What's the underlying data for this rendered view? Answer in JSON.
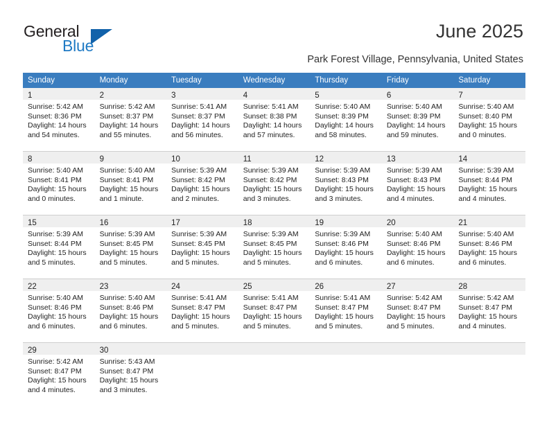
{
  "brand": {
    "name_top": "General",
    "name_bottom": "Blue",
    "color_dark": "#231f20",
    "color_blue": "#1f7ac4",
    "triangle_icon": "triangle-icon"
  },
  "header": {
    "title": "June 2025",
    "subtitle": "Park Forest Village, Pennsylvania, United States"
  },
  "calendar": {
    "header_bg": "#3a7dbf",
    "daynum_bg": "#efefef",
    "weekdays": [
      "Sunday",
      "Monday",
      "Tuesday",
      "Wednesday",
      "Thursday",
      "Friday",
      "Saturday"
    ],
    "weeks": [
      [
        {
          "day": "1",
          "sunrise": "Sunrise: 5:42 AM",
          "sunset": "Sunset: 8:36 PM",
          "daylight1": "Daylight: 14 hours",
          "daylight2": "and 54 minutes."
        },
        {
          "day": "2",
          "sunrise": "Sunrise: 5:42 AM",
          "sunset": "Sunset: 8:37 PM",
          "daylight1": "Daylight: 14 hours",
          "daylight2": "and 55 minutes."
        },
        {
          "day": "3",
          "sunrise": "Sunrise: 5:41 AM",
          "sunset": "Sunset: 8:37 PM",
          "daylight1": "Daylight: 14 hours",
          "daylight2": "and 56 minutes."
        },
        {
          "day": "4",
          "sunrise": "Sunrise: 5:41 AM",
          "sunset": "Sunset: 8:38 PM",
          "daylight1": "Daylight: 14 hours",
          "daylight2": "and 57 minutes."
        },
        {
          "day": "5",
          "sunrise": "Sunrise: 5:40 AM",
          "sunset": "Sunset: 8:39 PM",
          "daylight1": "Daylight: 14 hours",
          "daylight2": "and 58 minutes."
        },
        {
          "day": "6",
          "sunrise": "Sunrise: 5:40 AM",
          "sunset": "Sunset: 8:39 PM",
          "daylight1": "Daylight: 14 hours",
          "daylight2": "and 59 minutes."
        },
        {
          "day": "7",
          "sunrise": "Sunrise: 5:40 AM",
          "sunset": "Sunset: 8:40 PM",
          "daylight1": "Daylight: 15 hours",
          "daylight2": "and 0 minutes."
        }
      ],
      [
        {
          "day": "8",
          "sunrise": "Sunrise: 5:40 AM",
          "sunset": "Sunset: 8:41 PM",
          "daylight1": "Daylight: 15 hours",
          "daylight2": "and 0 minutes."
        },
        {
          "day": "9",
          "sunrise": "Sunrise: 5:40 AM",
          "sunset": "Sunset: 8:41 PM",
          "daylight1": "Daylight: 15 hours",
          "daylight2": "and 1 minute."
        },
        {
          "day": "10",
          "sunrise": "Sunrise: 5:39 AM",
          "sunset": "Sunset: 8:42 PM",
          "daylight1": "Daylight: 15 hours",
          "daylight2": "and 2 minutes."
        },
        {
          "day": "11",
          "sunrise": "Sunrise: 5:39 AM",
          "sunset": "Sunset: 8:42 PM",
          "daylight1": "Daylight: 15 hours",
          "daylight2": "and 3 minutes."
        },
        {
          "day": "12",
          "sunrise": "Sunrise: 5:39 AM",
          "sunset": "Sunset: 8:43 PM",
          "daylight1": "Daylight: 15 hours",
          "daylight2": "and 3 minutes."
        },
        {
          "day": "13",
          "sunrise": "Sunrise: 5:39 AM",
          "sunset": "Sunset: 8:43 PM",
          "daylight1": "Daylight: 15 hours",
          "daylight2": "and 4 minutes."
        },
        {
          "day": "14",
          "sunrise": "Sunrise: 5:39 AM",
          "sunset": "Sunset: 8:44 PM",
          "daylight1": "Daylight: 15 hours",
          "daylight2": "and 4 minutes."
        }
      ],
      [
        {
          "day": "15",
          "sunrise": "Sunrise: 5:39 AM",
          "sunset": "Sunset: 8:44 PM",
          "daylight1": "Daylight: 15 hours",
          "daylight2": "and 5 minutes."
        },
        {
          "day": "16",
          "sunrise": "Sunrise: 5:39 AM",
          "sunset": "Sunset: 8:45 PM",
          "daylight1": "Daylight: 15 hours",
          "daylight2": "and 5 minutes."
        },
        {
          "day": "17",
          "sunrise": "Sunrise: 5:39 AM",
          "sunset": "Sunset: 8:45 PM",
          "daylight1": "Daylight: 15 hours",
          "daylight2": "and 5 minutes."
        },
        {
          "day": "18",
          "sunrise": "Sunrise: 5:39 AM",
          "sunset": "Sunset: 8:45 PM",
          "daylight1": "Daylight: 15 hours",
          "daylight2": "and 5 minutes."
        },
        {
          "day": "19",
          "sunrise": "Sunrise: 5:39 AM",
          "sunset": "Sunset: 8:46 PM",
          "daylight1": "Daylight: 15 hours",
          "daylight2": "and 6 minutes."
        },
        {
          "day": "20",
          "sunrise": "Sunrise: 5:40 AM",
          "sunset": "Sunset: 8:46 PM",
          "daylight1": "Daylight: 15 hours",
          "daylight2": "and 6 minutes."
        },
        {
          "day": "21",
          "sunrise": "Sunrise: 5:40 AM",
          "sunset": "Sunset: 8:46 PM",
          "daylight1": "Daylight: 15 hours",
          "daylight2": "and 6 minutes."
        }
      ],
      [
        {
          "day": "22",
          "sunrise": "Sunrise: 5:40 AM",
          "sunset": "Sunset: 8:46 PM",
          "daylight1": "Daylight: 15 hours",
          "daylight2": "and 6 minutes."
        },
        {
          "day": "23",
          "sunrise": "Sunrise: 5:40 AM",
          "sunset": "Sunset: 8:46 PM",
          "daylight1": "Daylight: 15 hours",
          "daylight2": "and 6 minutes."
        },
        {
          "day": "24",
          "sunrise": "Sunrise: 5:41 AM",
          "sunset": "Sunset: 8:47 PM",
          "daylight1": "Daylight: 15 hours",
          "daylight2": "and 5 minutes."
        },
        {
          "day": "25",
          "sunrise": "Sunrise: 5:41 AM",
          "sunset": "Sunset: 8:47 PM",
          "daylight1": "Daylight: 15 hours",
          "daylight2": "and 5 minutes."
        },
        {
          "day": "26",
          "sunrise": "Sunrise: 5:41 AM",
          "sunset": "Sunset: 8:47 PM",
          "daylight1": "Daylight: 15 hours",
          "daylight2": "and 5 minutes."
        },
        {
          "day": "27",
          "sunrise": "Sunrise: 5:42 AM",
          "sunset": "Sunset: 8:47 PM",
          "daylight1": "Daylight: 15 hours",
          "daylight2": "and 5 minutes."
        },
        {
          "day": "28",
          "sunrise": "Sunrise: 5:42 AM",
          "sunset": "Sunset: 8:47 PM",
          "daylight1": "Daylight: 15 hours",
          "daylight2": "and 4 minutes."
        }
      ],
      [
        {
          "day": "29",
          "sunrise": "Sunrise: 5:42 AM",
          "sunset": "Sunset: 8:47 PM",
          "daylight1": "Daylight: 15 hours",
          "daylight2": "and 4 minutes."
        },
        {
          "day": "30",
          "sunrise": "Sunrise: 5:43 AM",
          "sunset": "Sunset: 8:47 PM",
          "daylight1": "Daylight: 15 hours",
          "daylight2": "and 3 minutes."
        },
        {
          "day": "",
          "sunrise": "",
          "sunset": "",
          "daylight1": "",
          "daylight2": ""
        },
        {
          "day": "",
          "sunrise": "",
          "sunset": "",
          "daylight1": "",
          "daylight2": ""
        },
        {
          "day": "",
          "sunrise": "",
          "sunset": "",
          "daylight1": "",
          "daylight2": ""
        },
        {
          "day": "",
          "sunrise": "",
          "sunset": "",
          "daylight1": "",
          "daylight2": ""
        },
        {
          "day": "",
          "sunrise": "",
          "sunset": "",
          "daylight1": "",
          "daylight2": ""
        }
      ]
    ]
  }
}
